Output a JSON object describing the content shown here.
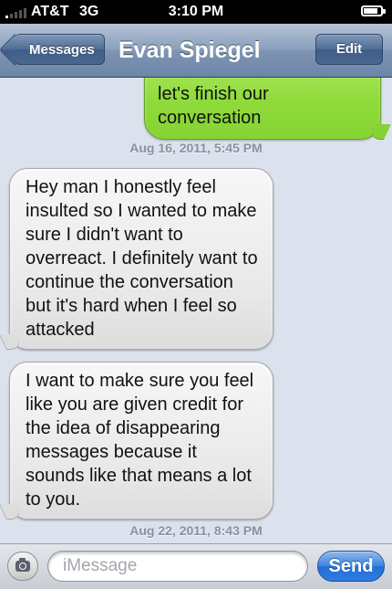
{
  "status_bar": {
    "carrier": "AT&T",
    "network": "3G",
    "time": "3:10 PM",
    "battery_level": 0.85
  },
  "nav": {
    "back_label": "Messages",
    "title": "Evan Spiegel",
    "edit_label": "Edit"
  },
  "thread": {
    "sent_message": {
      "line_1": "let's finish our",
      "line_2": "conversation"
    },
    "timestamps": [
      "Aug 16, 2011, 5:45 PM",
      "Aug 22, 2011, 8:43 PM"
    ],
    "received_messages": [
      "Hey man I honestly feel insulted so I wanted to make sure I didn't want to overreact. I definitely want to continue the conversation but it's hard when I feel so attacked",
      "I want to make sure you feel like you are given credit for the idea of disappearing messages because it sounds like that means a lot to you."
    ]
  },
  "composer": {
    "placeholder": "iMessage",
    "send_label": "Send"
  },
  "colors": {
    "sent_bubble": "#8fdb3b",
    "received_bubble": "#e8e8e8",
    "nav_bar": "#7d94b3",
    "send_button": "#236fd6",
    "background": "#dbe2ed"
  }
}
